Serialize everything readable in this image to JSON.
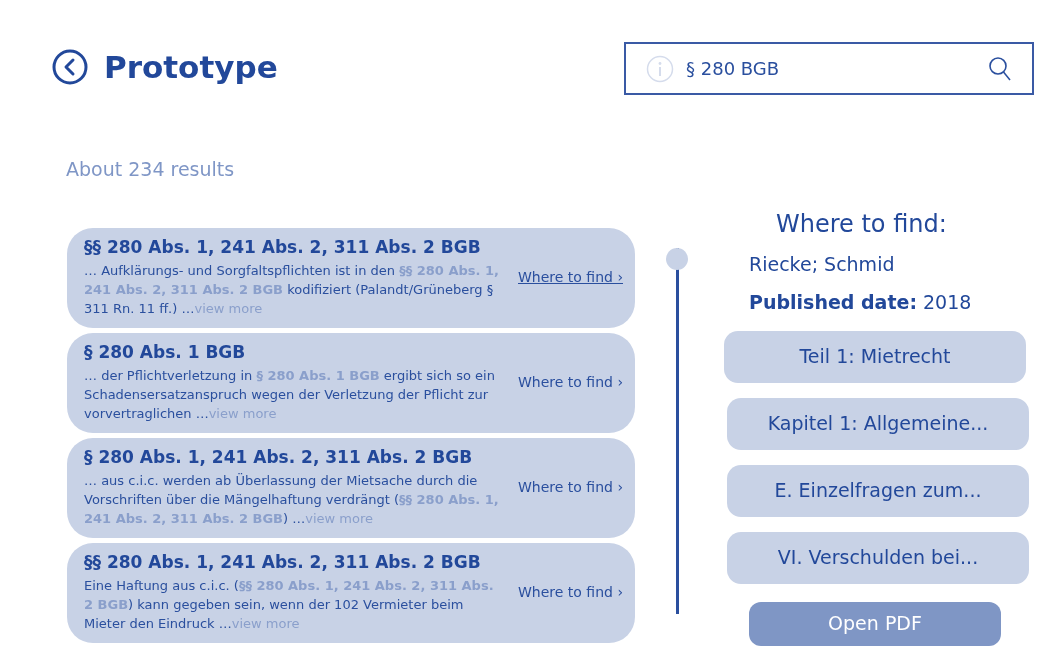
{
  "header": {
    "title": "Prototype"
  },
  "search": {
    "value": "§ 280 BGB"
  },
  "result_count": "About 234 results",
  "results": [
    {
      "title": "§§ 280 Abs. 1, 241 Abs. 2, 311 Abs. 2 BGB",
      "snippet": [
        {
          "text": "… Aufklärungs- und Sorgfaltspflichten ist in den ",
          "highlight": false
        },
        {
          "text": "§§ 280 Abs. 1, 241 Abs. 2, 311 Abs. 2 BGB",
          "highlight": true
        },
        {
          "text": " kodifiziert (Palandt/Grüneberg § 311 Rn. 11 ff.) …",
          "highlight": false
        }
      ],
      "more": "view more",
      "link": "Where to find ›",
      "selected": true
    },
    {
      "title": "§ 280 Abs. 1 BGB",
      "snippet": [
        {
          "text": "… der Pflichtverletzung in ",
          "highlight": false
        },
        {
          "text": "§ 280 Abs. 1 BGB",
          "highlight": true
        },
        {
          "text": " ergibt sich so ein Schadensersatzanspruch wegen der Verletzung der Pflicht zur vorvertraglichen …",
          "highlight": false
        }
      ],
      "more": "view more",
      "link": "Where to find ›",
      "selected": false
    },
    {
      "title": "§ 280 Abs. 1, 241 Abs. 2, 311 Abs. 2 BGB",
      "snippet": [
        {
          "text": "… aus c.i.c. werden ab Überlassung der Mietsache durch die Vorschriften über die Mängelhaftung verdrängt (",
          "highlight": false
        },
        {
          "text": "§§ 280 Abs. 1, 241 Abs. 2, 311 Abs. 2 BGB",
          "highlight": true
        },
        {
          "text": ") …",
          "highlight": false
        }
      ],
      "more": "view more",
      "link": "Where to find ›",
      "selected": false
    },
    {
      "title": "§§ 280 Abs. 1, 241 Abs. 2, 311 Abs. 2 BGB",
      "snippet": [
        {
          "text": "Eine Haftung aus c.i.c. (",
          "highlight": false
        },
        {
          "text": "§§ 280 Abs. 1, 241 Abs. 2, 311 Abs. 2 BGB",
          "highlight": true
        },
        {
          "text": ") kann gegeben sein, wenn der 102 Vermieter beim Mieter den Eindruck …",
          "highlight": false
        }
      ],
      "more": "view more",
      "link": "Where to find ›",
      "selected": false
    }
  ],
  "details": {
    "heading": "Where to find:",
    "authors": "Riecke; Schmid",
    "published_label": "Published date:",
    "published_value": "2018",
    "sections": [
      "Teil 1: Mietrecht",
      "Kapitel 1: Allgemeine...",
      "E. Einzelfragen zum...",
      "VI. Verschulden bei..."
    ],
    "open_button": "Open PDF"
  }
}
